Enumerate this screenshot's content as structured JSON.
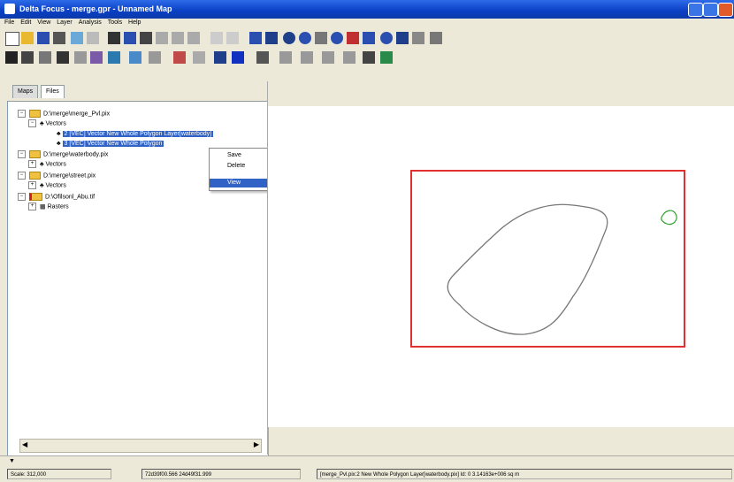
{
  "window": {
    "title": "Delta Focus - merge.gpr - Unnamed Map"
  },
  "menu": [
    "File",
    "Edit",
    "View",
    "Layer",
    "Analysis",
    "Tools",
    "Help"
  ],
  "tabs": [
    "Maps",
    "Files"
  ],
  "tree": {
    "n1": "D:\\merge\\merge_Pvl.pix",
    "n1_vectors": "Vectors",
    "n1_item1": "2 [VEC] Vector New Whole Polygon Layer[waterbody]",
    "n1_item2": "3 [VEC] Vector New Whole Polygon",
    "n2": "D:\\merge\\waterbody.pix",
    "n2_vectors": "Vectors",
    "n3": "D:\\merge\\street.pix",
    "n3_vectors": "Vectors",
    "n4": "D:\\Ofilsonl_Abu.tif",
    "n4_rasters": "Rasters"
  },
  "context_menu": [
    "Save",
    "Delete",
    "View"
  ],
  "status": {
    "scale": "Scale: 312,000",
    "coords": "72d39f00.566 24d49f31.999",
    "info": "[merge_Pvl.pix:2 New Whole Polygon Layer[waterbody.pix] Id: 0  3.14163e+006 sq m"
  },
  "colors": {
    "accent": "#3162c5",
    "frame": "#e03030",
    "polygon": "#777777",
    "small_shape": "#2ea02e"
  }
}
